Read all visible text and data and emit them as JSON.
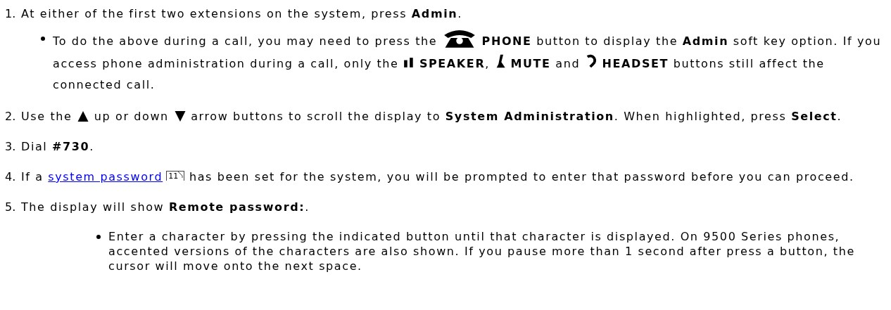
{
  "steps": [
    {
      "number": "1.",
      "paragraphs": [
        {
          "segments": [
            {
              "kind": "text",
              "text": "At either of the first two extensions on the system, press **Admin**."
            }
          ]
        }
      ],
      "bullets": [
        {
          "kind": "note",
          "segments": [
            {
              "kind": "text",
              "text": "To do the above during a call, you may need to press the "
            },
            {
              "kind": "phone_key"
            },
            {
              "kind": "text",
              "text": " **PHONE** button to display the **Admin** soft key option. If you access phone administration during a call, only the "
            },
            {
              "kind": "speaker_key"
            },
            {
              "kind": "text",
              "text": " **SPEAKER**, "
            },
            {
              "kind": "mute_key"
            },
            {
              "kind": "text",
              "text": " **MUTE** and "
            },
            {
              "kind": "headset_key"
            },
            {
              "kind": "text",
              "text": " **HEADSET** buttons still affect the connected call."
            }
          ]
        }
      ]
    },
    {
      "number": "2.",
      "paragraphs": [
        {
          "segments": [
            {
              "kind": "text",
              "text": "Use the "
            },
            {
              "kind": "up_key"
            },
            {
              "kind": "text",
              "text": " up or down "
            },
            {
              "kind": "down_key"
            },
            {
              "kind": "text",
              "text": " arrow buttons to scroll the display to **System Administration**. When highlighted, press **Select**."
            }
          ]
        }
      ]
    },
    {
      "number": "3.",
      "paragraphs": [
        {
          "segments": [
            {
              "kind": "text",
              "text": "Dial **#730**."
            }
          ]
        }
      ]
    },
    {
      "number": "4.",
      "paragraphs": [
        {
          "segments": [
            {
              "kind": "text",
              "text": "If a "
            },
            {
              "kind": "link",
              "text": "system password"
            },
            {
              "kind": "pageref",
              "text": "11"
            },
            {
              "kind": "text",
              "text": " has been set for the system, you will be prompted to enter that password before you can proceed."
            }
          ]
        }
      ]
    },
    {
      "number": "5.",
      "paragraphs": [
        {
          "segments": [
            {
              "kind": "text",
              "text": "The display will show **Remote password:**."
            }
          ]
        }
      ],
      "bullets": [
        {
          "kind": "tip",
          "segments": [
            {
              "kind": "text",
              "text": "Enter a character by pressing the indicated button until that character is displayed. On 9500 Series phones, accented versions of the characters are also shown. If you pause more than 1 second after press a button, the cursor will move onto the next space."
            }
          ]
        }
      ]
    }
  ]
}
